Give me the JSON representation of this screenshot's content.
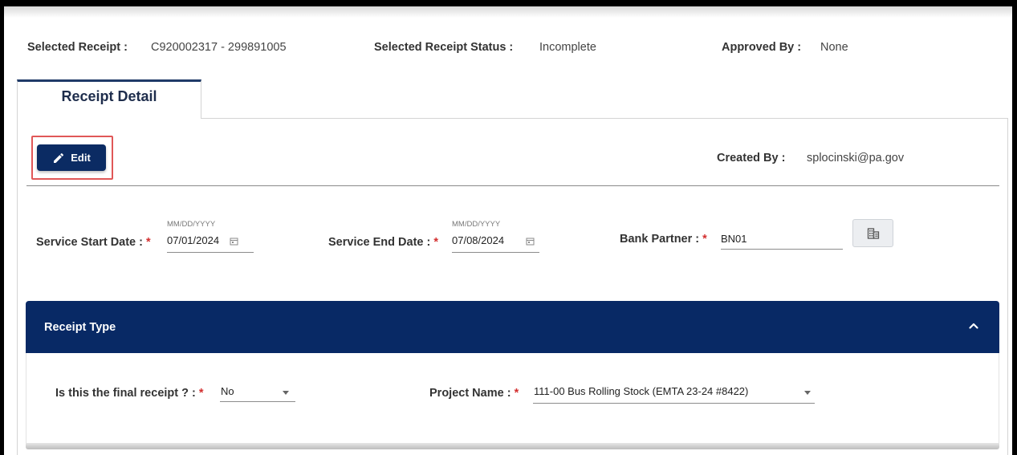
{
  "header": {
    "selected_receipt_label": "Selected Receipt :",
    "selected_receipt_value": "C920002317 - 299891005",
    "status_label": "Selected Receipt Status :",
    "status_value": "Incomplete",
    "approved_label": "Approved By :",
    "approved_value": "None"
  },
  "tabs": [
    {
      "label": "Receipt Detail",
      "active": true
    }
  ],
  "toolbar": {
    "edit_label": "Edit",
    "edit_icon": "pencil-icon",
    "created_by_label": "Created By :",
    "created_by_value": "splocinski@pa.gov"
  },
  "form": {
    "service_start": {
      "label": "Service Start Date :",
      "required_mark": "*",
      "hint": "MM/DD/YYYY",
      "value": "07/01/2024",
      "icon": "calendar-icon"
    },
    "service_end": {
      "label": "Service End Date :",
      "required_mark": "*",
      "hint": "MM/DD/YYYY",
      "value": "07/08/2024",
      "icon": "calendar-icon"
    },
    "bank_partner": {
      "label": "Bank Partner :",
      "required_mark": "*",
      "value": "BN01",
      "lookup_icon": "building-icon"
    }
  },
  "receipt_type_section": {
    "title": "Receipt Type",
    "expanded": true,
    "toggle_icon": "chevron-up-icon",
    "final_receipt": {
      "label": "Is this the final receipt ? :",
      "required_mark": "*",
      "value": "No"
    },
    "project_name": {
      "label": "Project Name :",
      "required_mark": "*",
      "value": "111-00 Bus Rolling Stock (EMTA 23-24 #8422)"
    }
  },
  "colors": {
    "primary_navy": "#082965",
    "button_navy": "#0b2b63",
    "required_red": "#d32f2f",
    "highlight_red": "#e05757"
  }
}
